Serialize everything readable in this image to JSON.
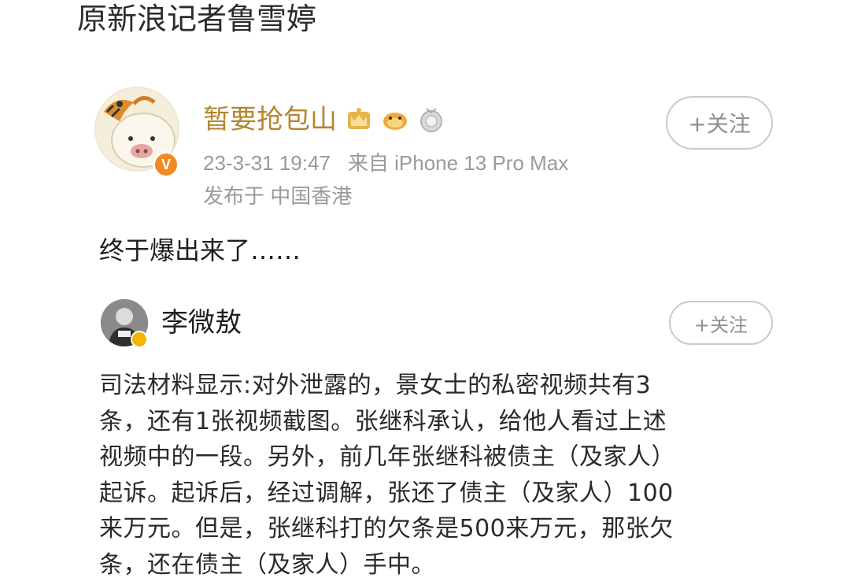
{
  "caption": "原新浪记者鲁雪婷",
  "main_post": {
    "username": "暂要抢包山",
    "verified_badge": "V",
    "timestamp": "23-3-31 19:47",
    "source": "来自 iPhone 13 Pro Max",
    "location": "发布于 中国香港",
    "follow_label": "+关注",
    "text": "终于爆出来了……",
    "medal_icons": [
      "crown-medal-icon",
      "fish-medal-icon",
      "silver-medal-icon"
    ]
  },
  "reposted": {
    "username": "李微敖",
    "follow_label": "+关注",
    "lines": [
      "司法材料显示:对外泄露的，景女士的私密视频共有3",
      "条，还有1张视频截图。张继科承认，给他人看过上述",
      "视频中的一段。另外，前几年张继科被债主（及家人）",
      "起诉。起诉后，经过调解，张还了债主（及家人）100",
      "来万元。但是，张继科打的欠条是500来万元，那张欠",
      "条，还在债主（及家人）手中。"
    ]
  },
  "colors": {
    "username_gold": "#b5862e",
    "meta_gray": "#9a9a9a",
    "badge_orange": "#f08a24"
  }
}
